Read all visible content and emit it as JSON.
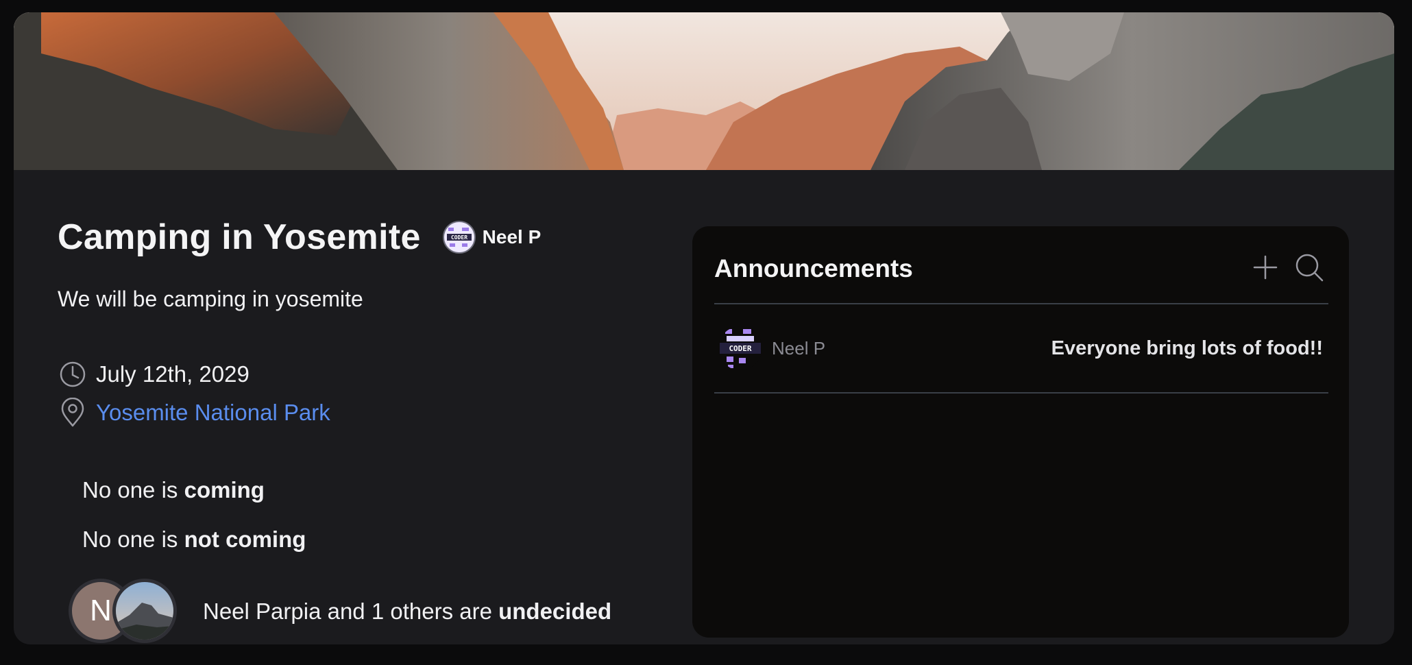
{
  "event": {
    "title": "Camping in Yosemite",
    "description": "We will be camping in yosemite",
    "host": {
      "name": "Neel P",
      "avatar_text": "CODER"
    },
    "date": "July 12th, 2029",
    "location": "Yosemite National Park",
    "link_color": "#5a8dee"
  },
  "rsvp": {
    "coming": {
      "prefix": "No one is ",
      "status": "coming"
    },
    "not_coming": {
      "prefix": "No one is ",
      "status": "not coming"
    },
    "undecided": {
      "prefix": "Neel Parpia and 1 others are ",
      "status": "undecided",
      "avatar_initial": "N"
    }
  },
  "announcements": {
    "title": "Announcements",
    "add_icon": "plus-icon",
    "search_icon": "search-icon",
    "items": [
      {
        "author": "Neel P",
        "message": "Everyone bring lots of food!!",
        "avatar_text": "CODER"
      }
    ]
  },
  "icons": {
    "date": "clock-icon",
    "location": "map-pin-icon"
  }
}
